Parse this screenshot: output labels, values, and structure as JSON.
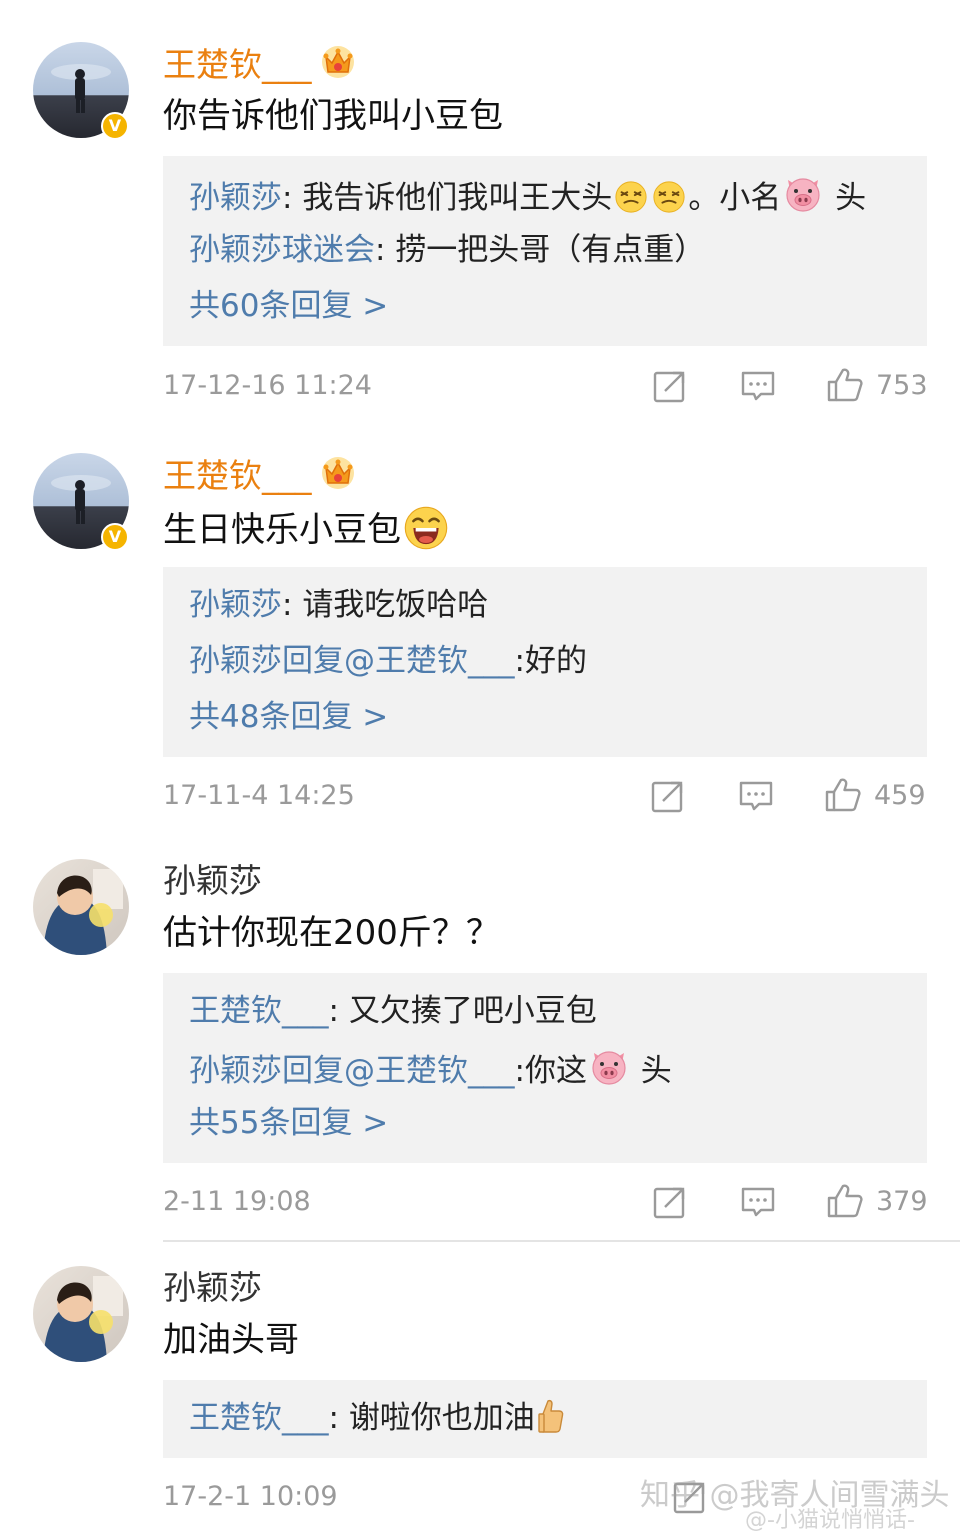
{
  "comments": [
    {
      "user": "王楚钦___",
      "text": "你告诉他们我叫小豆包",
      "replies": [
        {
          "name": "孙颖莎",
          "sep": ": ",
          "text": "我告诉他们我叫王大头",
          "text2": "。小名",
          "text3": " 头"
        },
        {
          "name": "孙颖莎球迷会",
          "sep": ": ",
          "text": "捞一把头哥（有点重）"
        }
      ],
      "more": "共60条回复 >",
      "time": "17-12-16 11:24",
      "likes": "753"
    },
    {
      "user": "王楚钦___",
      "text": "生日快乐小豆包",
      "replies": [
        {
          "name": "孙颖莎",
          "sep": ": ",
          "text": "请我吃饭哈哈"
        },
        {
          "name": "孙颖莎回复@王楚钦___",
          "sep": ":",
          "text": "好的"
        }
      ],
      "more": "共48条回复 >",
      "time": "17-11-4 14:25",
      "likes": "459"
    },
    {
      "user": "孙颖莎",
      "text": "估计你现在200斤？？",
      "replies": [
        {
          "name": "王楚钦___",
          "sep": ": ",
          "text": "又欠揍了吧小豆包"
        },
        {
          "name": "孙颖莎回复@王楚钦___",
          "sep": ":",
          "text": "你这",
          "text3": " 头"
        }
      ],
      "more": "共55条回复 >",
      "time": "2-11 19:08",
      "likes": "379"
    },
    {
      "user": "孙颖莎",
      "text": "加油头哥",
      "replies": [
        {
          "name": "王楚钦___",
          "sep": ": ",
          "text": "谢啦你也加油"
        }
      ],
      "time": "17-2-1 10:09"
    }
  ],
  "watermark": {
    "line1": "知乎 @我寄人间雪满头",
    "line2": "@-小猫说悄悄话-"
  },
  "icons": {
    "share": "share-icon",
    "comment": "comment-icon",
    "like": "thumbs-up-icon",
    "crown": "crown-vip-icon",
    "verified": "verified-badge-icon",
    "pig": "pig-face-emoji",
    "dizzy": "dizzy-face-emoji",
    "laugh": "laughing-face-emoji",
    "thumb": "thumbs-up-emoji"
  },
  "colors": {
    "vip_name": "#ea8010",
    "link": "#4f7cac",
    "meta": "#9a9a9a",
    "reply_bg": "#f2f2f2"
  }
}
